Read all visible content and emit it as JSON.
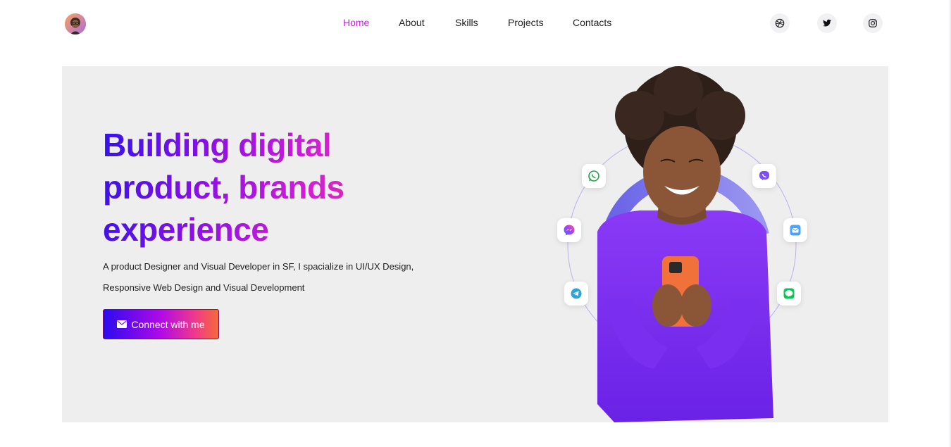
{
  "header": {
    "logo_alt": "profile avatar logo",
    "nav": [
      {
        "label": "Home",
        "active": true
      },
      {
        "label": "About",
        "active": false
      },
      {
        "label": "Skills",
        "active": false
      },
      {
        "label": "Projects",
        "active": false
      },
      {
        "label": "Contacts",
        "active": false
      }
    ],
    "social": [
      "dribbble-icon",
      "twitter-icon",
      "instagram-icon"
    ]
  },
  "hero": {
    "headline_line1": "Building digital",
    "headline_line2": "product, brands",
    "headline_line3": "experience",
    "subtext_line1": "A product Designer and Visual Developer in SF, I spacialize in UI/UX Design,",
    "subtext_line2": "Responsive Web Design and Visual Development",
    "cta_label": "Connect with me",
    "cta_icon": "envelope-icon",
    "app_icons": [
      "whatsapp-icon",
      "viber-icon",
      "messenger-icon",
      "mail-app-icon",
      "telegram-icon",
      "line-icon"
    ]
  },
  "colors": {
    "accent": "#c321d8",
    "hero_bg": "#eeeeee",
    "gradient_start": "#3413e8",
    "gradient_end": "#f0407f",
    "sweater": "#7a2bf0"
  }
}
